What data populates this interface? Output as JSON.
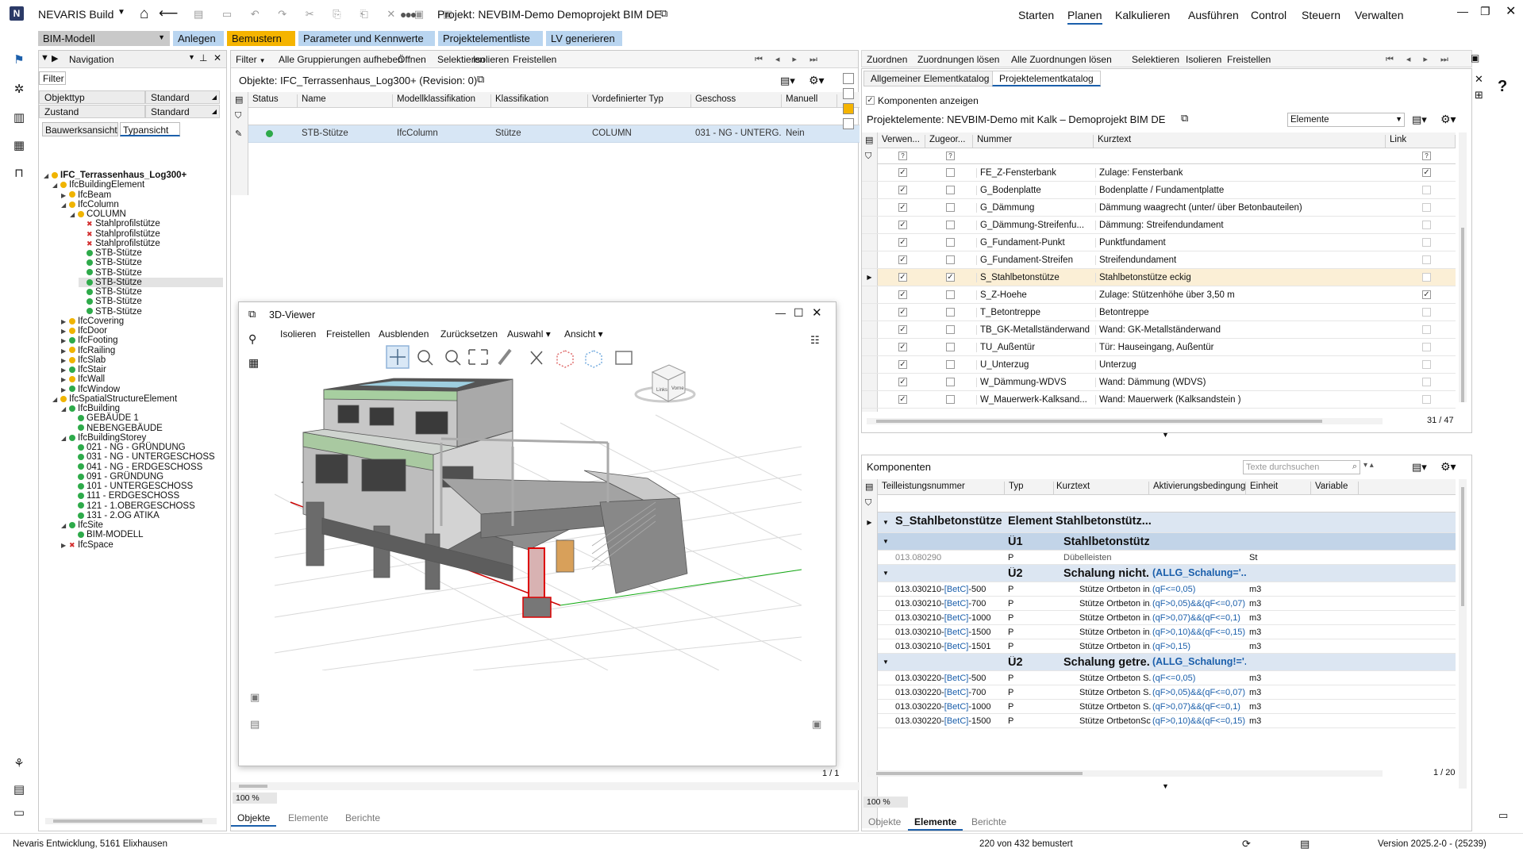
{
  "app": {
    "name": "NEVARIS Build",
    "project_title": "Projekt: NEVBIM-Demo Demoprojekt BIM DE"
  },
  "main_menu": [
    "Starten",
    "Planen",
    "Kalkulieren",
    "Ausführen",
    "Control",
    "Steuern",
    "Verwalten"
  ],
  "active_menu": "Planen",
  "ribbon": {
    "dropdown": "BIM-Modell",
    "buttons": [
      "Anlegen",
      "Bemustern",
      "Parameter und Kennwerte",
      "Projektelementliste",
      "LV generieren"
    ],
    "active": "Bemustern"
  },
  "navigation": {
    "title": "Navigation",
    "filter_tab": "Filter",
    "rows": [
      {
        "label": "Objekttyp",
        "value": "Standard"
      },
      {
        "label": "Zustand",
        "value": "Standard"
      }
    ],
    "tabs": [
      "Bauwerksansicht",
      "Typansicht"
    ],
    "active_tab": "Typansicht",
    "tree": [
      {
        "t": "IFC_Terrassenhaus_Log300+",
        "l": 0,
        "s": "y",
        "e": "open",
        "b": true
      },
      {
        "t": "IfcBuildingElement",
        "l": 1,
        "s": "y",
        "e": "open"
      },
      {
        "t": "IfcBeam",
        "l": 2,
        "s": "y",
        "e": "closed"
      },
      {
        "t": "IfcColumn",
        "l": 2,
        "s": "y",
        "e": "open"
      },
      {
        "t": "COLUMN",
        "l": 3,
        "s": "y",
        "e": "open"
      },
      {
        "t": "Stahlprofilstütze",
        "l": 4,
        "s": "r"
      },
      {
        "t": "Stahlprofilstütze",
        "l": 4,
        "s": "r"
      },
      {
        "t": "Stahlprofilstütze",
        "l": 4,
        "s": "r"
      },
      {
        "t": "STB-Stütze",
        "l": 4,
        "s": "g"
      },
      {
        "t": "STB-Stütze",
        "l": 4,
        "s": "g"
      },
      {
        "t": "STB-Stütze",
        "l": 4,
        "s": "g"
      },
      {
        "t": "STB-Stütze",
        "l": 4,
        "s": "g",
        "sel": true
      },
      {
        "t": "STB-Stütze",
        "l": 4,
        "s": "g"
      },
      {
        "t": "STB-Stütze",
        "l": 4,
        "s": "g"
      },
      {
        "t": "STB-Stütze",
        "l": 4,
        "s": "g"
      },
      {
        "t": "IfcCovering",
        "l": 2,
        "s": "y",
        "e": "closed"
      },
      {
        "t": "IfcDoor",
        "l": 2,
        "s": "y",
        "e": "closed"
      },
      {
        "t": "IfcFooting",
        "l": 2,
        "s": "g",
        "e": "closed"
      },
      {
        "t": "IfcRailing",
        "l": 2,
        "s": "y",
        "e": "closed"
      },
      {
        "t": "IfcSlab",
        "l": 2,
        "s": "y",
        "e": "closed"
      },
      {
        "t": "IfcStair",
        "l": 2,
        "s": "g",
        "e": "closed"
      },
      {
        "t": "IfcWall",
        "l": 2,
        "s": "y",
        "e": "closed"
      },
      {
        "t": "IfcWindow",
        "l": 2,
        "s": "g",
        "e": "closed"
      },
      {
        "t": "IfcSpatialStructureElement",
        "l": 1,
        "s": "y",
        "e": "open"
      },
      {
        "t": "IfcBuilding",
        "l": 2,
        "s": "g",
        "e": "open"
      },
      {
        "t": "GEBÄUDE 1",
        "l": 3,
        "s": "g"
      },
      {
        "t": "NEBENGEBÄUDE",
        "l": 3,
        "s": "g"
      },
      {
        "t": "IfcBuildingStorey",
        "l": 2,
        "s": "g",
        "e": "open"
      },
      {
        "t": "021 - NG - GRÜNDUNG",
        "l": 3,
        "s": "g"
      },
      {
        "t": "031 - NG - UNTERGESCHOSS",
        "l": 3,
        "s": "g"
      },
      {
        "t": "041 - NG - ERDGESCHOSS",
        "l": 3,
        "s": "g"
      },
      {
        "t": "091 - GRÜNDUNG",
        "l": 3,
        "s": "g"
      },
      {
        "t": "101 - UNTERGESCHOSS",
        "l": 3,
        "s": "g"
      },
      {
        "t": "111 - ERDGESCHOSS",
        "l": 3,
        "s": "g"
      },
      {
        "t": "121 - 1.OBERGESCHOSS",
        "l": 3,
        "s": "g"
      },
      {
        "t": "131 - 2.OG ATIKA",
        "l": 3,
        "s": "g"
      },
      {
        "t": "IfcSite",
        "l": 2,
        "s": "g",
        "e": "open"
      },
      {
        "t": "BIM-MODELL",
        "l": 3,
        "s": "g"
      },
      {
        "t": "IfcSpace",
        "l": 2,
        "s": "r",
        "e": "closed"
      }
    ]
  },
  "objects_panel": {
    "toolbar": [
      "Filter",
      "Alle Gruppierungen aufheben",
      "Öffnen",
      "Selektieren",
      "Isolieren",
      "Freistellen"
    ],
    "title": "Objekte: IFC_Terrassenhaus_Log300+ (Revision: 0)",
    "columns": [
      "Status",
      "Name",
      "Modellklassifikation",
      "Klassifikation",
      "Vordefinierter Typ",
      "Geschoss",
      "Manuell"
    ],
    "row": [
      "STB-Stütze",
      "IfcColumn",
      "Stütze",
      "COLUMN",
      "031 - NG - UNTERG...",
      "Nein"
    ],
    "paging": "1 / 1",
    "zoom": "100 %",
    "tabs": [
      "Objekte",
      "Elemente",
      "Berichte"
    ],
    "active_tab": "Objekte"
  },
  "viewer": {
    "title": "3D-Viewer",
    "menu": [
      "Isolieren",
      "Freistellen",
      "Ausblenden",
      "Zurücksetzen",
      "Auswahl ▾",
      "Ansicht ▾"
    ],
    "cube_labels": [
      "Links",
      "Vorne"
    ]
  },
  "right_toolbar": [
    "Zuordnen",
    "Zuordnungen lösen",
    "Alle Zuordnungen lösen",
    "Selektieren",
    "Isolieren",
    "Freistellen"
  ],
  "catalog": {
    "tabs": [
      "Allgemeiner Elementkatalog",
      "Projektelementkatalog"
    ],
    "active_tab": "Projektelementkatalog",
    "show_components": "Komponenten anzeigen",
    "title": "Projektelemente: NEVBIM-Demo mit Kalk – Demoprojekt BIM DE",
    "dropdown": "Elemente",
    "columns": [
      "Verwen...",
      "Zugeor...",
      "Nummer",
      "Kurztext",
      "Link"
    ],
    "rows": [
      {
        "v": true,
        "z": false,
        "n": "FE_Z-Fensterbank",
        "k": "Zulage: Fensterbank",
        "l": true
      },
      {
        "v": true,
        "z": false,
        "n": "G_Bodenplatte",
        "k": "Bodenplatte / Fundamentplatte",
        "l": false
      },
      {
        "v": true,
        "z": false,
        "n": "G_Dämmung",
        "k": "Dämmung waagrecht (unter/ über Betonbauteilen)",
        "l": false
      },
      {
        "v": true,
        "z": false,
        "n": "G_Dämmung-Streifenfu...",
        "k": "Dämmung: Streifendundament",
        "l": false
      },
      {
        "v": true,
        "z": false,
        "n": "G_Fundament-Punkt",
        "k": "Punktfundament",
        "l": false
      },
      {
        "v": true,
        "z": false,
        "n": "G_Fundament-Streifen",
        "k": "Streifendundament",
        "l": false
      },
      {
        "v": true,
        "z": true,
        "n": "S_Stahlbetonstütze",
        "k": "Stahlbetonstütze eckig",
        "l": false,
        "sel": true
      },
      {
        "v": true,
        "z": false,
        "n": "S_Z-Hoehe",
        "k": "Zulage: Stützenhöhe über 3,50 m",
        "l": true
      },
      {
        "v": true,
        "z": false,
        "n": "T_Betontreppe",
        "k": "Betontreppe",
        "l": false
      },
      {
        "v": true,
        "z": false,
        "n": "TB_GK-Metallständerwand",
        "k": "Wand: GK-Metallständerwand",
        "l": false
      },
      {
        "v": true,
        "z": false,
        "n": "TÜ_Außentür",
        "k": "Tür: Hauseingang, Außentür",
        "l": false
      },
      {
        "v": true,
        "z": false,
        "n": "U_Unterzug",
        "k": "Unterzug",
        "l": false
      },
      {
        "v": true,
        "z": false,
        "n": "W_Dämmung-WDVS",
        "k": "Wand: Dämmung (WDVS)",
        "l": false
      },
      {
        "v": true,
        "z": false,
        "n": "W_Mauerwerk-Kalksand...",
        "k": "Wand: Mauerwerk (Kalksandstein )",
        "l": false
      }
    ],
    "count": "31 / 47"
  },
  "components": {
    "title": "Komponenten",
    "search_placeholder": "Texte durchsuchen",
    "columns": [
      "Teilleistungsnummer",
      "Typ",
      "Kurztext",
      "Aktivierungsbedingung",
      "Einheit",
      "Variable"
    ],
    "rows": [
      {
        "kind": "group",
        "n": "S_Stahlbetonstütze",
        "typ": "Element",
        "k": "Stahlbetonstütz..."
      },
      {
        "kind": "sub",
        "typ": "Ü1",
        "k": "Stahlbetonstütz..."
      },
      {
        "kind": "item",
        "n": "013.080290",
        "typ": "P",
        "k": "Dübelleisten",
        "e": "St",
        "grey": true
      },
      {
        "kind": "sub2",
        "typ": "Ü2",
        "k": "Schalung nicht...",
        "a": "(ALLG_Schalung='..."
      },
      {
        "kind": "item",
        "n": "013.030210-",
        "tag": "[BetC]",
        "suf": "-500",
        "typ": "P",
        "k": "Stütze Ortbeton in...",
        "a": "(qF<=0,05)",
        "e": "m3"
      },
      {
        "kind": "item",
        "n": "013.030210-",
        "tag": "[BetC]",
        "suf": "-700",
        "typ": "P",
        "k": "Stütze Ortbeton in...",
        "a": "(qF>0,05)&&(qF<=0,07)",
        "e": "m3"
      },
      {
        "kind": "item",
        "n": "013.030210-",
        "tag": "[BetC]",
        "suf": "-1000",
        "typ": "P",
        "k": "Stütze Ortbeton in...",
        "a": "(qF>0,07)&&(qF<=0,1)",
        "e": "m3"
      },
      {
        "kind": "item",
        "n": "013.030210-",
        "tag": "[BetC]",
        "suf": "-1500",
        "typ": "P",
        "k": "Stütze Ortbeton in...",
        "a": "(qF>0,10)&&(qF<=0,15)",
        "e": "m3"
      },
      {
        "kind": "item",
        "n": "013.030210-",
        "tag": "[BetC]",
        "suf": "-1501",
        "typ": "P",
        "k": "Stütze Ortbeton in...",
        "a": "(qF>0,15)",
        "e": "m3"
      },
      {
        "kind": "sub2",
        "typ": "Ü2",
        "k": "Schalung getre...",
        "a": "(ALLG_Schalung!='..."
      },
      {
        "kind": "item",
        "n": "013.030220-",
        "tag": "[BetC]",
        "suf": "-500",
        "typ": "P",
        "k": "Stütze Ortbeton S...",
        "a": "(qF<=0,05)",
        "e": "m3"
      },
      {
        "kind": "item",
        "n": "013.030220-",
        "tag": "[BetC]",
        "suf": "-700",
        "typ": "P",
        "k": "Stütze Ortbeton S...",
        "a": "(qF>0,05)&&(qF<=0,07)",
        "e": "m3"
      },
      {
        "kind": "item",
        "n": "013.030220-",
        "tag": "[BetC]",
        "suf": "-1000",
        "typ": "P",
        "k": "Stütze Ortbeton S...",
        "a": "(qF>0,07)&&(qF<=0,1)",
        "e": "m3"
      },
      {
        "kind": "item",
        "n": "013.030220-",
        "tag": "[BetC]",
        "suf": "-1500",
        "typ": "P",
        "k": "Stütze OrtbetonSc...",
        "a": "(qF>0,10)&&(qF<=0,15)",
        "e": "m3"
      }
    ],
    "count": "1 / 20",
    "zoom": "100 %",
    "tabs": [
      "Objekte",
      "Elemente",
      "Berichte"
    ],
    "active_tab": "Elemente"
  },
  "status": {
    "company": "Nevaris Entwicklung, 5161 Elixhausen",
    "count": "220 von 432 bemustert",
    "version": "Version 2025.2-0 - (25239)"
  },
  "colors": {
    "ribbon_blue": "#b9d5f0",
    "ribbon_active": "#f5b400",
    "sel_row": "#d7e6f5",
    "cat_sel": "#fbefd6",
    "comp_group": "#dce6f2",
    "comp_sub": "#c2d4e8"
  }
}
